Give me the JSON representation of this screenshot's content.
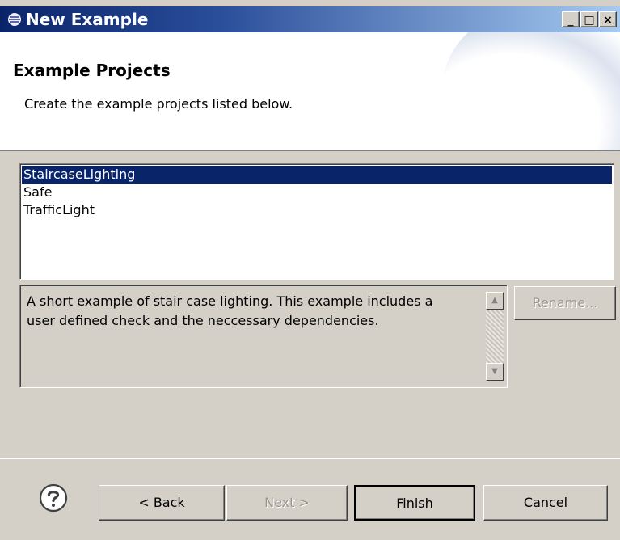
{
  "window": {
    "title": "New Example",
    "controls": [
      "minimize",
      "maximize",
      "close"
    ],
    "accent": "#0a246a"
  },
  "header": {
    "title": "Example Projects",
    "description": "Create the example projects listed below."
  },
  "projects": {
    "items": [
      "StaircaseLighting",
      "Safe",
      "TrafficLight"
    ],
    "selected": "StaircaseLighting"
  },
  "details": {
    "text": "A short example of stair case lighting. This example includes a user defined check and the neccessary dependencies.",
    "rename_label": "Rename..."
  },
  "buttons": {
    "back": "< Back",
    "next": "Next >",
    "finish": "Finish",
    "cancel": "Cancel"
  },
  "icons": {
    "help": "help-icon",
    "app": "eclipse-icon"
  }
}
